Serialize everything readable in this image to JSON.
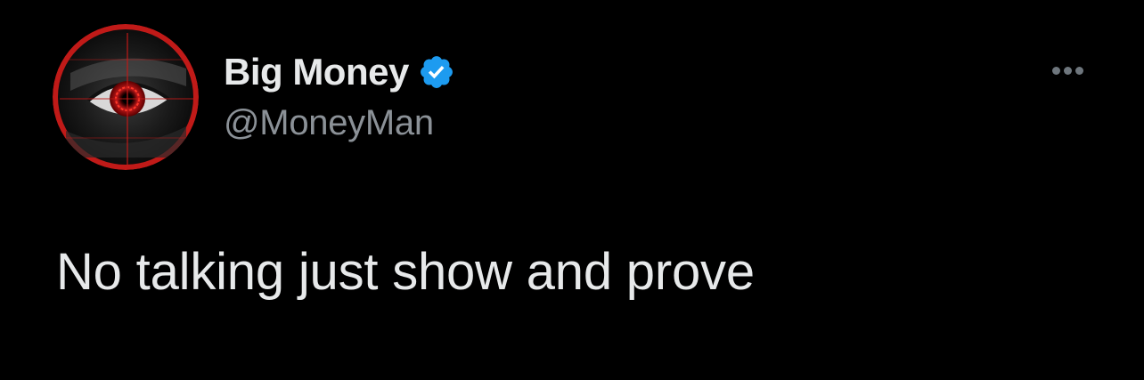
{
  "author": {
    "display_name": "Big Money",
    "handle": "@MoneyMan",
    "verified": true,
    "avatar_icon": "red-eye-avatar-icon"
  },
  "tweet": {
    "text": "No talking just show and prove"
  },
  "menu": {
    "icon": "more-options-icon"
  },
  "colors": {
    "background": "#000000",
    "primary_text": "#e7e9ea",
    "secondary_text": "#8b9197",
    "verified_badge": "#1d9bf0",
    "avatar_accent": "#d0201c"
  }
}
